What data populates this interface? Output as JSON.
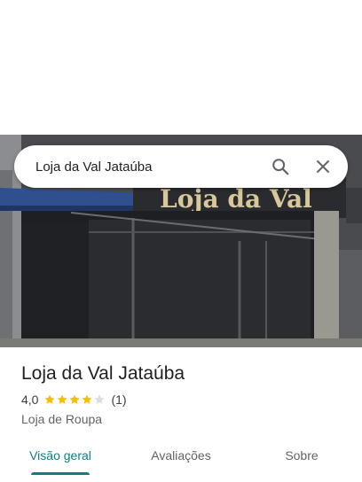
{
  "search": {
    "query": "Loja da Val Jataúba",
    "search_icon": "search-icon",
    "close_icon": "close-icon"
  },
  "photo": {
    "sign_text": "Loja da Val"
  },
  "place": {
    "name": "Loja da Val Jataúba",
    "rating": "4,0",
    "rating_value": 4.0,
    "stars_max": 5,
    "review_count": "(1)",
    "category": "Loja de Roupa"
  },
  "tabs": [
    {
      "label": "Visão geral",
      "active": true
    },
    {
      "label": "Avaliações",
      "active": false
    },
    {
      "label": "Sobre",
      "active": false
    }
  ],
  "colors": {
    "accent": "#0b7e84",
    "star_filled": "#fbbc04",
    "star_empty": "#dadce0"
  }
}
